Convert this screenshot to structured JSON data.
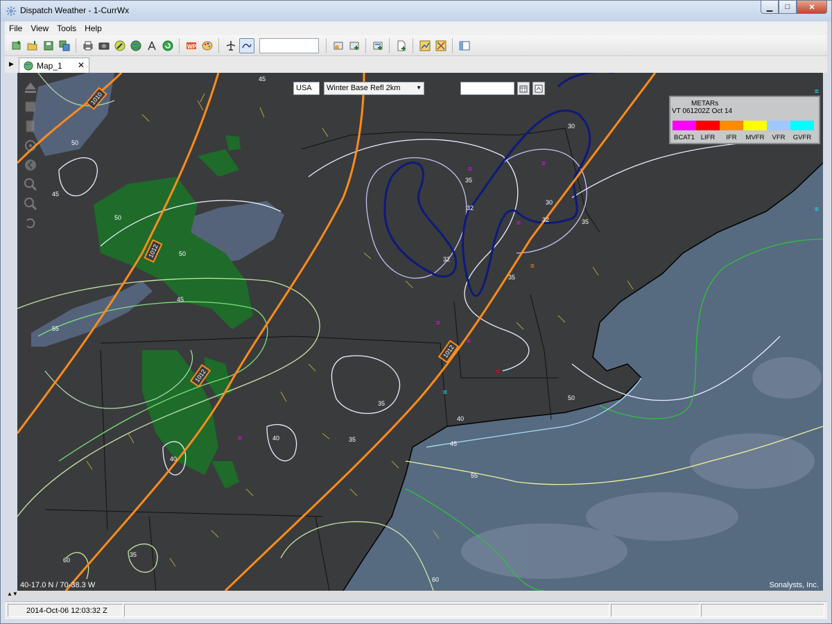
{
  "window": {
    "title": "Dispatch Weather - 1-CurrWx"
  },
  "window_controls": {
    "minimize": "▁",
    "maximize": "□",
    "close": "✕"
  },
  "menu": {
    "items": [
      "File",
      "View",
      "Tools",
      "Help"
    ]
  },
  "toolbar": {
    "text_input_value": ""
  },
  "tabs": [
    {
      "label": "Map_1",
      "close": "✕"
    }
  ],
  "map_controls": {
    "region": "USA",
    "layer": "Winter Base Refl 2km",
    "time_value": ""
  },
  "legend": {
    "title": "METARs",
    "valid_time": "VT 061202Z Oct 14",
    "categories": [
      {
        "label": "BCAT1",
        "color": "#ff00ff"
      },
      {
        "label": "LIFR",
        "color": "#ff0000"
      },
      {
        "label": "IFR",
        "color": "#ff8c00"
      },
      {
        "label": "MVFR",
        "color": "#ffff00"
      },
      {
        "label": "VFR",
        "color": "#9ec8ff"
      },
      {
        "label": "GVFR",
        "color": "#00ffff"
      }
    ]
  },
  "map": {
    "coord_readout": "40-17.0 N / 70-38.3 W",
    "credit": "Sonalysts, Inc.",
    "isobar_labels": [
      "1010",
      "1012",
      "1012",
      "1012"
    ],
    "temp_labels": [
      "50",
      "50",
      "45",
      "45",
      "50",
      "45",
      "55",
      "40",
      "40",
      "35",
      "35",
      "35",
      "32",
      "32",
      "30",
      "30",
      "32",
      "35",
      "35",
      "40",
      "35",
      "45",
      "50",
      "55",
      "60",
      "60",
      "35",
      "32",
      "35",
      "35"
    ],
    "colors": {
      "land": "#3a3b3d",
      "water": "#4d5a6a",
      "ocean": "#5a6e86",
      "isobar": "#ff8c1a",
      "freezing": "#0d1a7a",
      "radar": "#1e6b2a"
    }
  },
  "status": {
    "datetime": "2014-Oct-06 12:03:32 Z"
  }
}
